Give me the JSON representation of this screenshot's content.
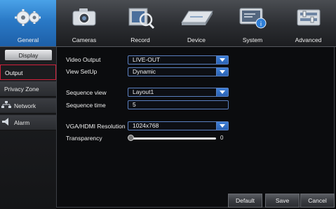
{
  "tabs": [
    {
      "label": "General",
      "icon": "gear-icon",
      "active": true
    },
    {
      "label": "Cameras",
      "icon": "camera-icon",
      "active": false
    },
    {
      "label": "Record",
      "icon": "record-film-icon",
      "active": false
    },
    {
      "label": "Device",
      "icon": "hard-drive-icon",
      "active": false
    },
    {
      "label": "System",
      "icon": "system-monitor-icon",
      "active": false
    },
    {
      "label": "Advanced",
      "icon": "advanced-settings-icon",
      "active": false
    }
  ],
  "sidebar": {
    "items": [
      {
        "label": "Display"
      },
      {
        "label": "Output"
      },
      {
        "label": "Privacy Zone"
      },
      {
        "label": "Network",
        "icon": "network-icon"
      },
      {
        "label": "Alarm",
        "icon": "alarm-icon"
      }
    ]
  },
  "form": {
    "video_output": {
      "label": "Video Output",
      "value": "LIVE-OUT"
    },
    "view_setup": {
      "label": "View SetUp",
      "value": "Dynamic"
    },
    "sequence_view": {
      "label": "Sequence view",
      "value": "Layout1"
    },
    "sequence_time": {
      "label": "Sequence time",
      "value": "5"
    },
    "resolution": {
      "label": "VGA/HDMI Resolution",
      "value": "1024x768"
    },
    "transparency": {
      "label": "Transparency",
      "value": "0"
    }
  },
  "buttons": {
    "default": "Default",
    "save": "Save",
    "cancel": "Cancel"
  },
  "colors": {
    "accent": "#2a79c6",
    "selected_border": "#d0203a"
  }
}
